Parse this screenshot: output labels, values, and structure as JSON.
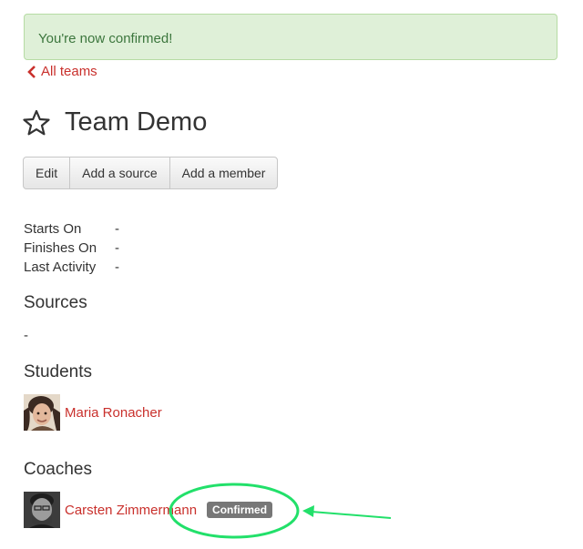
{
  "alert": {
    "message": "You're now confirmed!"
  },
  "nav": {
    "back_label": "All teams",
    "back_icon": "chevron-left-icon"
  },
  "team": {
    "name": "Team Demo",
    "favorite_icon": "star-outline-icon"
  },
  "toolbar": {
    "edit_label": "Edit",
    "add_source_label": "Add a source",
    "add_member_label": "Add a member"
  },
  "details": [
    {
      "label": "Starts On",
      "value": "-"
    },
    {
      "label": "Finishes On",
      "value": "-"
    },
    {
      "label": "Last Activity",
      "value": "-"
    }
  ],
  "sources": {
    "heading": "Sources",
    "empty_value": "-"
  },
  "students": {
    "heading": "Students",
    "members": [
      {
        "name": "Maria Ronacher"
      }
    ]
  },
  "coaches": {
    "heading": "Coaches",
    "members": [
      {
        "name": "Carsten Zimmermann",
        "status_badge": "Confirmed"
      }
    ]
  },
  "colors": {
    "link": "#c9302c",
    "alert_bg": "#dff0d8",
    "alert_text": "#3c763d",
    "badge_bg": "#777777",
    "annotation": "#22e06a"
  }
}
